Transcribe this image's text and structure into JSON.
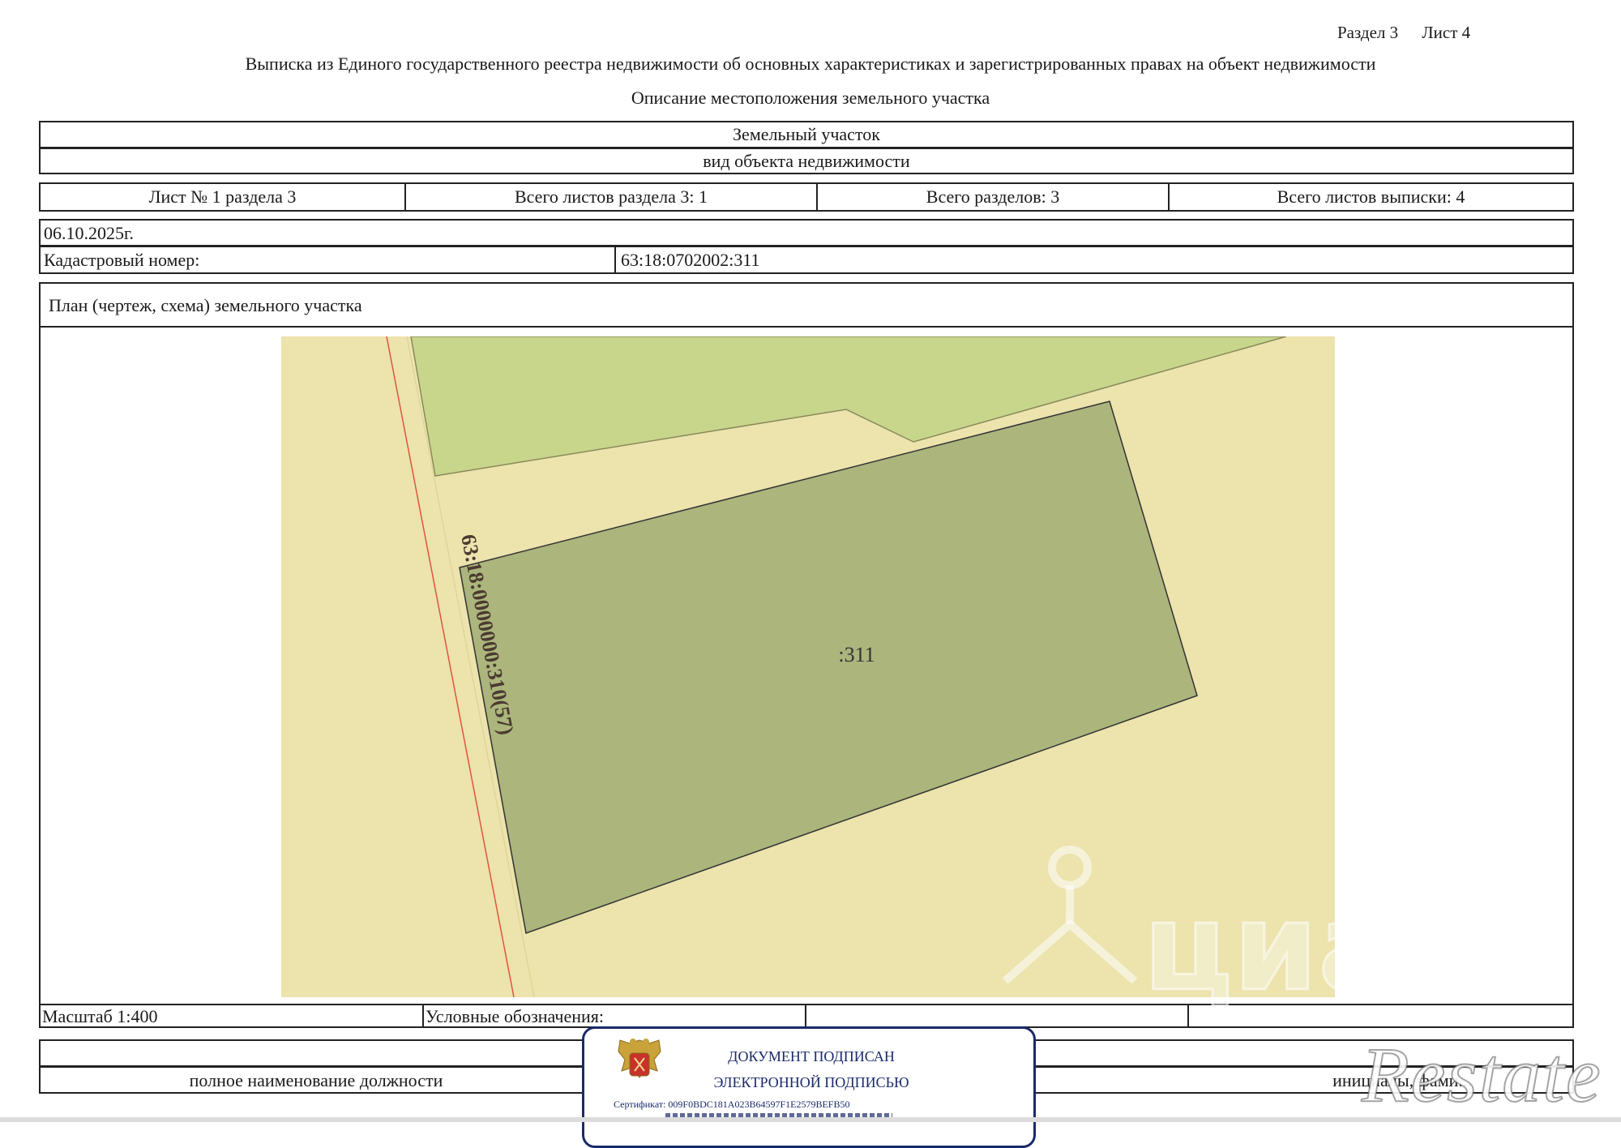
{
  "header": {
    "section": "Раздел 3",
    "sheet": "Лист 4",
    "title": "Выписка из Единого государственного реестра недвижимости об основных характеристиках и зарегистрированных правах на объект недвижимости",
    "subtitle": "Описание местоположения земельного участка"
  },
  "object": {
    "name": "Земельный участок",
    "kind_caption": "вид объекта недвижимости"
  },
  "sheets": {
    "sheet_no": "Лист № 1 раздела 3",
    "total_sheets_section": "Всего листов раздела 3: 1",
    "total_sections": "Всего разделов: 3",
    "total_sheets_extract": "Всего листов выписки: 4"
  },
  "date": "06.10.2025г.",
  "cadastral": {
    "label": "Кадастровый номер:",
    "value": "63:18:0702002:311"
  },
  "plan": {
    "heading": "План (чертеж, схема) земельного участка",
    "parcel_label": ":311",
    "road_label": "63:18:0000000:310(57)",
    "colors": {
      "background": "#ece3ad",
      "green_area": "#c8d68c",
      "parcel": "#abb57c",
      "boundary_red": "#e0553f"
    }
  },
  "footer": {
    "scale": "Масштаб 1:400",
    "legend": "Условные обозначения:",
    "position_caption": "полное наименование должности",
    "initials_caption": "инициалы, фами..."
  },
  "stamp": {
    "line1": "ДОКУМЕНТ ПОДПИСАН",
    "line2": "ЭЛЕКТРОННОЙ ПОДПИСЬЮ",
    "certificate": "Сертификат: 009F0BDC181A023B64597F1E2579BEFB50"
  },
  "watermarks": {
    "cian": "циан",
    "restate": "Restate"
  }
}
